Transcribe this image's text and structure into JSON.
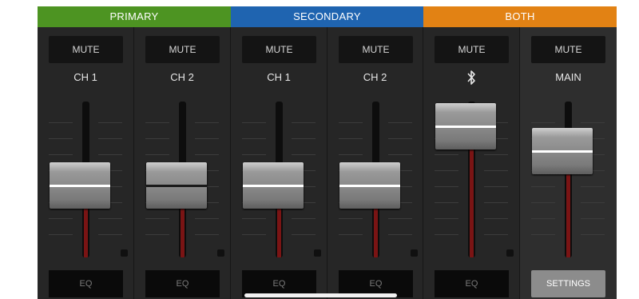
{
  "groups": [
    {
      "label": "PRIMARY",
      "color": "#4d9422"
    },
    {
      "label": "SECONDARY",
      "color": "#1f64b0"
    },
    {
      "label": "BOTH",
      "color": "#e28214"
    }
  ],
  "channels": [
    {
      "mute_label": "MUTE",
      "label": "CH 1",
      "fader_level": 0.46,
      "button_label": "EQ"
    },
    {
      "mute_label": "MUTE",
      "label": "CH 2",
      "fader_level": 0.46,
      "button_label": "EQ"
    },
    {
      "mute_label": "MUTE",
      "label": "CH 1",
      "fader_level": 0.46,
      "button_label": "EQ"
    },
    {
      "mute_label": "MUTE",
      "label": "CH 2",
      "fader_level": 0.46,
      "button_label": "EQ"
    },
    {
      "mute_label": "MUTE",
      "icon": "bluetooth-icon",
      "fader_level": 0.84,
      "button_label": "EQ"
    },
    {
      "mute_label": "MUTE",
      "label": "MAIN",
      "fader_level": 0.68,
      "button_label": "SETTINGS"
    }
  ]
}
